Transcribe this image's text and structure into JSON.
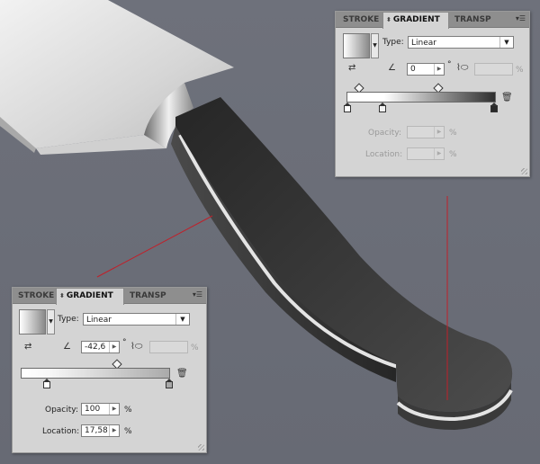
{
  "panel_bottom": {
    "tabs": {
      "stroke": "STROKE",
      "gradient": "GRADIENT",
      "transparency": "TRANSP"
    },
    "type_label": "Type:",
    "type_value": "Linear",
    "angle_value": "-42,6",
    "angle_unit": "°",
    "aspect_unit": "%",
    "opacity_label": "Opacity:",
    "opacity_value": "100",
    "opacity_unit": "%",
    "location_label": "Location:",
    "location_value": "17,58",
    "location_unit": "%"
  },
  "panel_top": {
    "tabs": {
      "stroke": "STROKE",
      "gradient": "GRADIENT",
      "transparency": "TRANSP"
    },
    "type_label": "Type:",
    "type_value": "Linear",
    "angle_value": "0",
    "angle_unit": "°",
    "aspect_unit": "%",
    "opacity_label": "Opacity:",
    "opacity_value": "",
    "opacity_unit": "%",
    "location_label": "Location:",
    "location_value": "",
    "location_unit": "%"
  },
  "colors": {
    "background": "#6b6e78",
    "handle_dark": "#2c2c2c",
    "handle_light": "#4a4a4a",
    "blade_light": "#e6e6e6",
    "guide_line": "#c0202a"
  }
}
